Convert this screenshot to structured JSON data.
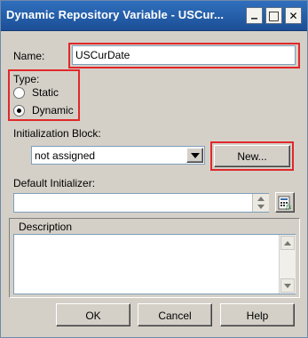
{
  "window": {
    "title": "Dynamic Repository Variable - USCur...",
    "controls": {
      "minimize": "_",
      "maximize": "□",
      "close": "✕"
    }
  },
  "name": {
    "label": "Name:",
    "value": "USCurDate"
  },
  "type": {
    "label": "Type:",
    "options": [
      {
        "label": "Static",
        "selected": false
      },
      {
        "label": "Dynamic",
        "selected": true
      }
    ]
  },
  "init_block": {
    "label": "Initialization Block:",
    "value": "not assigned",
    "new_button": "New..."
  },
  "default_initializer": {
    "label": "Default Initializer:",
    "value": "",
    "editor_icon": "expression-builder-icon"
  },
  "description": {
    "label": "Description",
    "value": ""
  },
  "buttons": {
    "ok": "OK",
    "cancel": "Cancel",
    "help": "Help"
  },
  "colors": {
    "highlight": "#e0282a",
    "titlebar": "#2f6fbd",
    "dialog_bg": "#d4d0c8"
  }
}
